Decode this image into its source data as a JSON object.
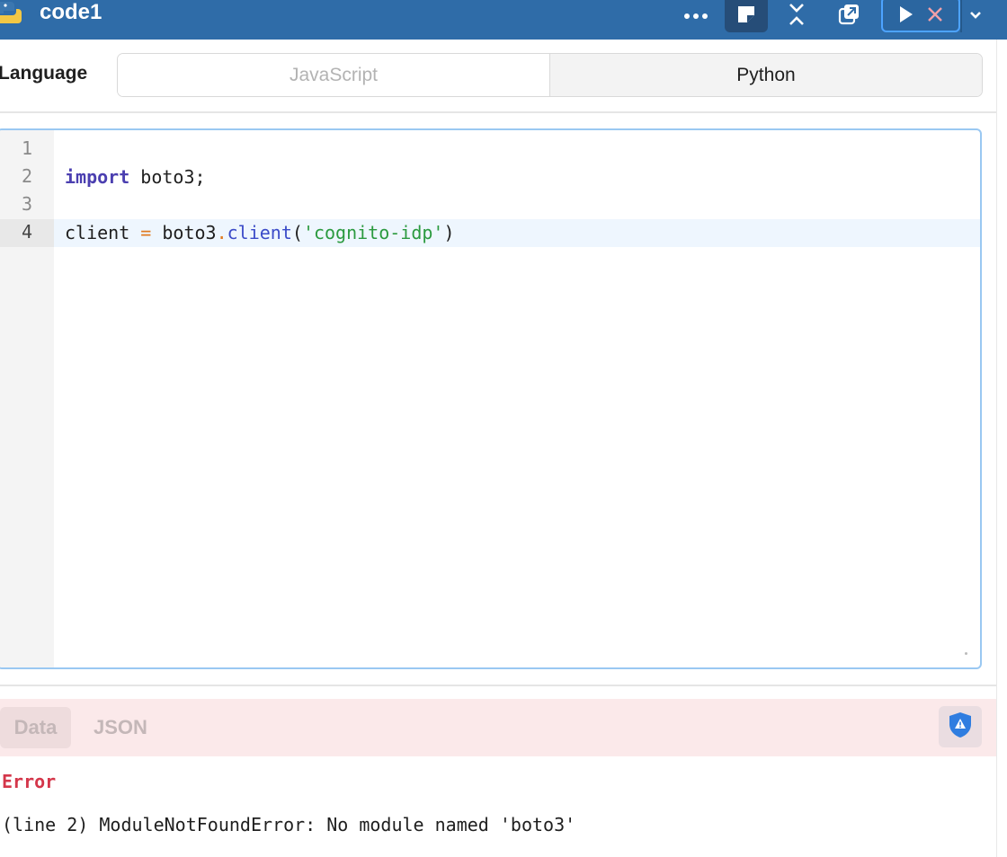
{
  "header": {
    "title": "code1",
    "icons": [
      "python-logo-icon",
      "more-icon",
      "note-icon",
      "collapse-icon",
      "popout-icon",
      "play-icon",
      "close-icon",
      "chevron-down-icon"
    ]
  },
  "language": {
    "label": "Language",
    "options": [
      "JavaScript",
      "Python"
    ],
    "selected": "Python"
  },
  "editor": {
    "line_numbers": [
      "1",
      "2",
      "3",
      "4"
    ],
    "active_line": "4",
    "lines": {
      "l2_kw": "import",
      "l2_rest": " boto3;",
      "l4_var": "client ",
      "l4_op": "=",
      "l4_obj": " boto3",
      "l4_dot": ".",
      "l4_fn": "client",
      "l4_open": "(",
      "l4_str": "'cognito-idp'",
      "l4_close": ")"
    }
  },
  "result": {
    "tabs": [
      "Data",
      "JSON"
    ],
    "error_title": "Error",
    "error_message": "(line 2) ModuleNotFoundError: No module named 'boto3'"
  },
  "colors": {
    "header_bg": "#2f6ca8",
    "error_red": "#d4364a",
    "error_bar_bg": "#fbe9ea",
    "editor_focus_border": "#9ac8f2"
  }
}
